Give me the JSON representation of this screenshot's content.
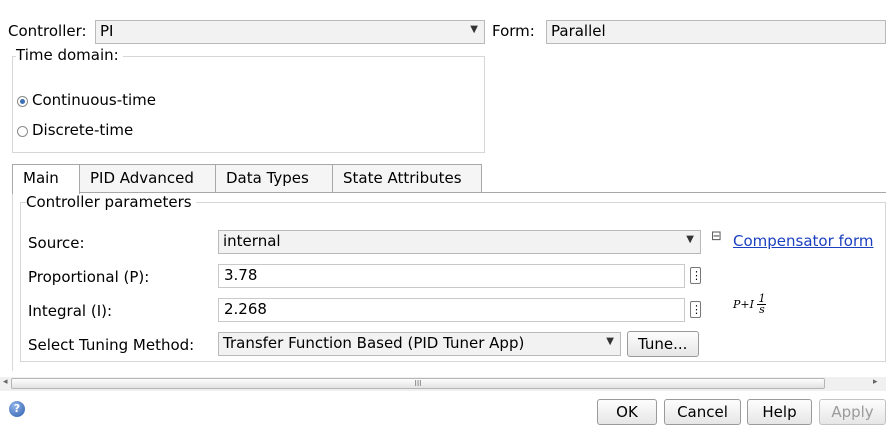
{
  "controller": {
    "label": "Controller:",
    "value": "PI"
  },
  "form": {
    "label": "Form:",
    "value": "Parallel"
  },
  "time_domain": {
    "title": "Time domain:",
    "options": [
      "Continuous-time",
      "Discrete-time"
    ],
    "selected": "Continuous-time"
  },
  "tabs": [
    "Main",
    "PID Advanced",
    "Data Types",
    "State Attributes"
  ],
  "active_tab": "Main",
  "controller_parameters": {
    "title": "Controller parameters",
    "source": {
      "label": "Source:",
      "value": "internal"
    },
    "proportional": {
      "label": "Proportional (P):",
      "value": "3.78"
    },
    "integral": {
      "label": "Integral (I):",
      "value": "2.268"
    },
    "tuning": {
      "label": "Select Tuning Method:",
      "value": "Transfer Function Based (PID Tuner App)",
      "button": "Tune..."
    }
  },
  "compensator": {
    "toggle": "⊟",
    "link": "Compensator form",
    "formula_prefix": "P+I",
    "formula_num": "1",
    "formula_den": "s"
  },
  "scrollbar": {
    "thumb_text": "III"
  },
  "footer": {
    "ok": "OK",
    "cancel": "Cancel",
    "help": "Help",
    "apply": "Apply"
  },
  "icons": {
    "help": "help-icon",
    "dropdown": "chevron-down-icon",
    "dots": "vertical-dots-icon"
  }
}
